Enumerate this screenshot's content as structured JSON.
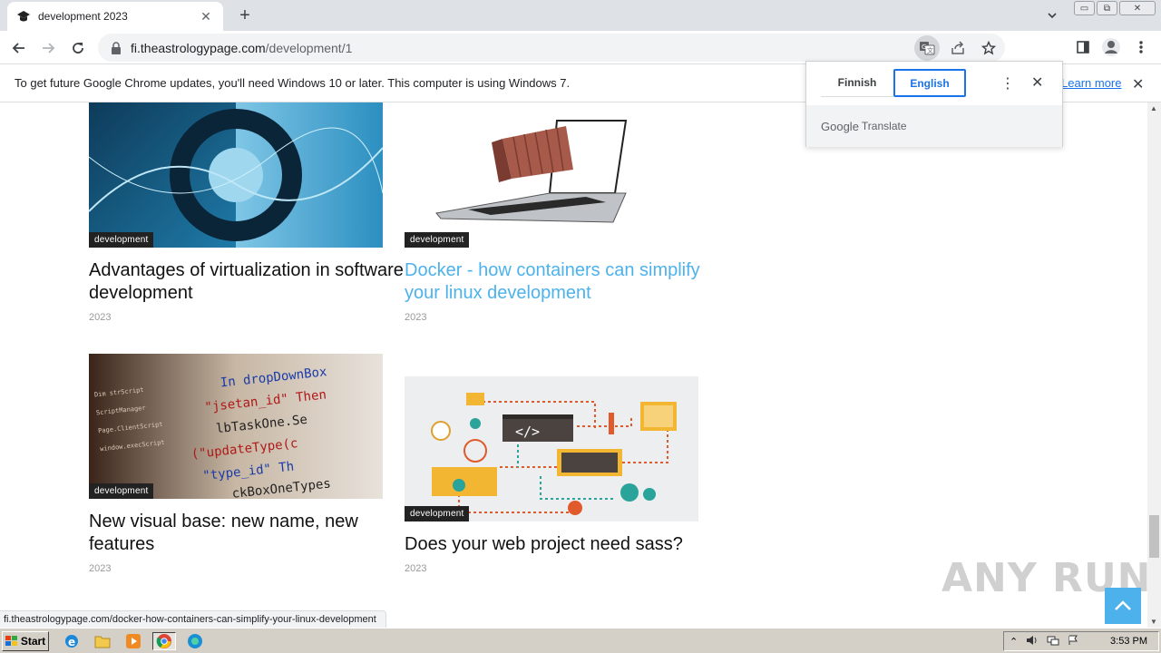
{
  "browser": {
    "tab_title": "development 2023",
    "tab_close": "✕",
    "new_tab": "+",
    "url_host": "fi.theastrologypage.com",
    "url_path": "/development/1",
    "window_min": "▭",
    "window_restore": "⧉",
    "window_close": "✕"
  },
  "infobar": {
    "message": "To get future Google Chrome updates, you'll need Windows 10 or later. This computer is using Windows 7.",
    "learn_more": "Learn more",
    "close": "✕"
  },
  "translate_popup": {
    "source_lang": "Finnish",
    "target_lang": "English",
    "menu": "⋮",
    "close": "✕",
    "brand_google": "Google",
    "brand_translate": "Translate"
  },
  "articles": [
    {
      "title": "Advantages of virtualization in software development",
      "category": "development",
      "year": "2023",
      "hovered": false
    },
    {
      "title": "Docker - how containers can simplify your linux development",
      "category": "development",
      "year": "2023",
      "hovered": true
    },
    {
      "title": "New visual base: new name, new features",
      "category": "development",
      "year": "2023",
      "hovered": false
    },
    {
      "title": "Does your web project need sass?",
      "category": "development",
      "year": "2023",
      "hovered": false
    }
  ],
  "status_url": "fi.theastrologypage.com/docker-how-containers-can-simplify-your-linux-development",
  "watermark": "ANY RUN",
  "taskbar": {
    "start": "Start",
    "clock": "3:53 PM"
  },
  "colors": {
    "link_accent": "#4db2ec",
    "chrome_blue": "#1a73e8"
  }
}
